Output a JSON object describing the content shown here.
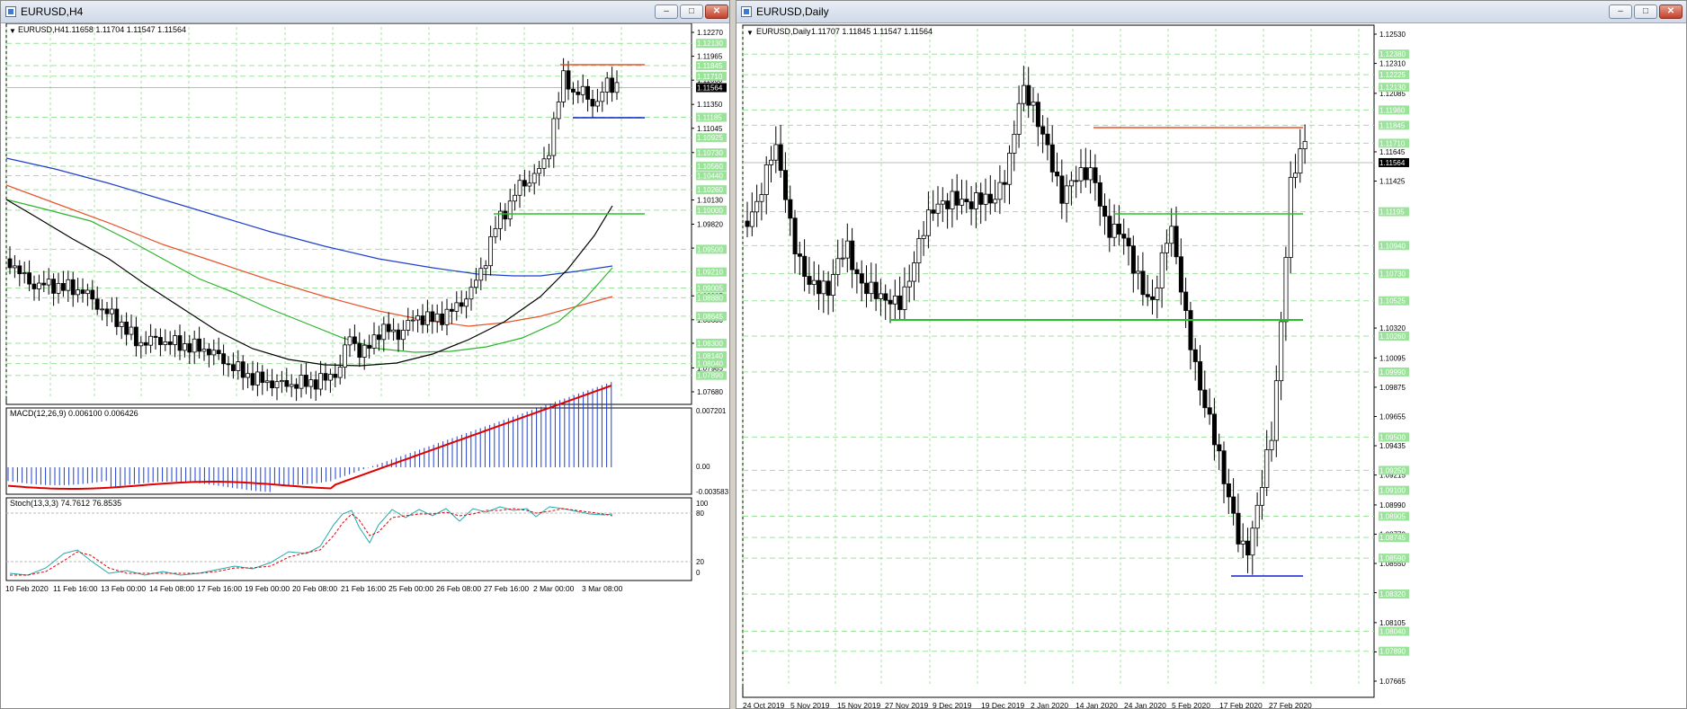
{
  "left_window": {
    "title": "EURUSD,H4",
    "buttons": {
      "minimize": "–",
      "maximize": "□",
      "close": "✕"
    },
    "header_symbol": "EURUSD,H4",
    "header_ohlc": "1.11658 1.11704 1.11547 1.11564",
    "macd_label": "MACD(12,26,9) 0.006100 0.006426",
    "stoch_label": "Stoch(13,3,3) 74.7612 76.8535",
    "price_axis": {
      "scale_labels": [
        "1.12270",
        "1.11965",
        "1.11660",
        "1.11350",
        "1.11045",
        "1.10735",
        "1.10130",
        "1.09820",
        "1.09515",
        "1.08905",
        "1.08600",
        "1.08300",
        "1.07985",
        "1.07680"
      ],
      "highlight_labels": [
        "1.12130",
        "1.11845",
        "1.11710",
        "1.11185",
        "1.10925",
        "1.10730",
        "1.10560",
        "1.10440",
        "1.10260",
        "1.10000",
        "1.09500",
        "1.09210",
        "1.09005",
        "1.08880",
        "1.08645",
        "1.08300",
        "1.08140",
        "1.08040",
        "1.07890"
      ],
      "current_price": "1.11564"
    },
    "macd_axis": [
      "0.007201",
      "0.00",
      "-0.003583"
    ],
    "stoch_axis": [
      "100",
      "80",
      "20",
      "0"
    ],
    "time_labels": [
      "10 Feb 2020",
      "11 Feb 16:00",
      "13 Feb 00:00",
      "14 Feb 08:00",
      "17 Feb 16:00",
      "19 Feb 00:00",
      "20 Feb 08:00",
      "21 Feb 16:00",
      "25 Feb 00:00",
      "26 Feb 08:00",
      "27 Feb 16:00",
      "2 Mar 00:00",
      "3 Mar 08:00"
    ]
  },
  "right_window": {
    "title": "EURUSD,Daily",
    "buttons": {
      "minimize": "–",
      "maximize": "□",
      "close": "✕"
    },
    "header_symbol": "EURUSD,Daily",
    "header_ohlc": "1.11707 1.11845 1.11547 1.11564",
    "price_axis": {
      "scale_labels": [
        "1.12530",
        "1.12310",
        "1.12085",
        "1.11645",
        "1.11425",
        "1.10320",
        "1.10095",
        "1.09875",
        "1.09655",
        "1.09435",
        "1.09215",
        "1.08990",
        "1.08770",
        "1.08550",
        "1.08330",
        "1.08105",
        "1.07885",
        "1.07665"
      ],
      "highlight_labels": [
        "1.12380",
        "1.12225",
        "1.12130",
        "1.11960",
        "1.11845",
        "1.11710",
        "1.11195",
        "1.10940",
        "1.10730",
        "1.10525",
        "1.10260",
        "1.09990",
        "1.09500",
        "1.09250",
        "1.09100",
        "1.08905",
        "1.08745",
        "1.08590",
        "1.08320",
        "1.08040",
        "1.07890"
      ],
      "current_price": "1.11564"
    },
    "time_labels": [
      "24 Oct 2019",
      "5 Nov 2019",
      "15 Nov 2019",
      "27 Nov 2019",
      "9 Dec 2019",
      "19 Dec 2019",
      "2 Jan 2020",
      "14 Jan 2020",
      "24 Jan 2020",
      "5 Feb 2020",
      "17 Feb 2020",
      "27 Feb 2020"
    ]
  },
  "colors": {
    "grid_h": "#9be39b",
    "grid_v": "#b0d8b0",
    "bull": "#ffffff",
    "bear": "#000000",
    "ma_blue": "#1f3fcc",
    "ma_red": "#e8542a",
    "ma_green": "#2bb52b",
    "ma_black": "#000000",
    "level_orange": "#e8542a",
    "level_blue": "#1020d0",
    "level_green": "#2bc02b",
    "highlight_bg": "#9be39b",
    "current_bg": "#000000",
    "macd_hist": "#1f3fcc",
    "macd_signal": "#e00000",
    "stoch_main": "#22aaaa",
    "stoch_signal": "#e00000"
  }
}
